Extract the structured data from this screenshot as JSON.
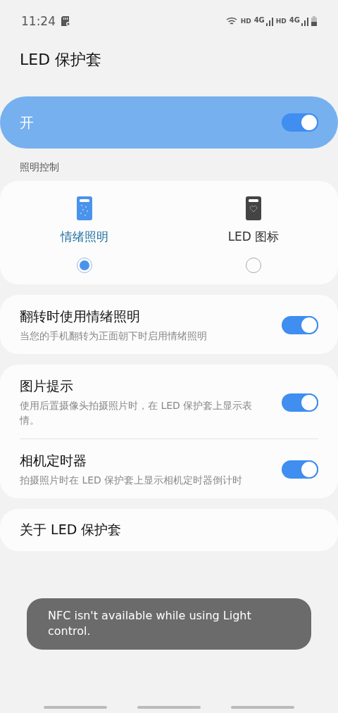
{
  "status_bar": {
    "time": "11:24",
    "networks": [
      {
        "hd": "HD",
        "gen": "4G"
      },
      {
        "hd": "HD",
        "gen": "4G"
      }
    ]
  },
  "title": "LED 保护套",
  "master": {
    "label": "开",
    "on": true
  },
  "section_label": "照明控制",
  "modes": [
    {
      "label": "情绪照明",
      "kind": "mood",
      "selected": true
    },
    {
      "label": "LED 图标",
      "kind": "icon",
      "selected": false
    }
  ],
  "groups": [
    [
      {
        "title": "翻转时使用情绪照明",
        "description": "当您的手机翻转为正面朝下时启用情绪照明",
        "on": true
      }
    ],
    [
      {
        "title": "图片提示",
        "description": "使用后置摄像头拍摄照片时，在 LED 保护套上显示表情。",
        "on": true
      },
      {
        "title": "相机定时器",
        "description": "拍摄照片时在 LED 保护套上显示相机定时器倒计时",
        "on": true
      }
    ],
    [
      {
        "title": "关于 LED 保护套"
      }
    ]
  ],
  "toast": "NFC isn't available while using Light control."
}
